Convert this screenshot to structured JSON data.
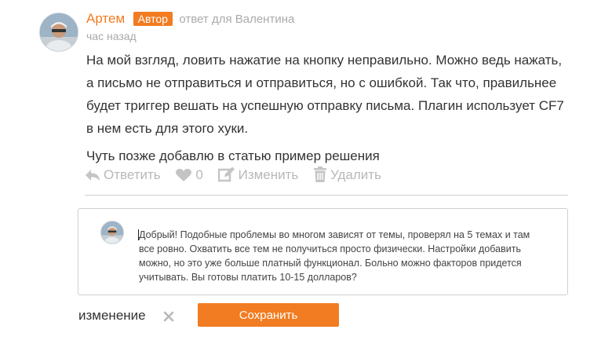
{
  "comment": {
    "author": "Артем",
    "badge": "Автор",
    "reply_to": "ответ для Валентина",
    "time": "час назад",
    "paragraphs": [
      "На мой взгляд, ловить нажатие на кнопку неправильно. Можно ведь нажать, а письмо не отправиться и отправиться, но с ошибкой. Так что, правильнее будет триггер вешать на успешную отправку письма. Плагин использует CF7 в нем есть для этого хуки.",
      "Чуть позже добавлю в статью пример решения"
    ],
    "actions": {
      "reply_label": "Ответить",
      "likes": "0",
      "edit_label": "Изменить",
      "delete_label": "Удалить"
    }
  },
  "editor": {
    "value": "Добрый! Подобные проблемы во многом зависят от темы, проверял на 5 темах и там все ровно. Охватить все тем не получиться просто физически. Настройки добавить можно, но это уже больше платный функционал. Больно можно факторов придется учитывать. Вы готовы платить 10-15 долларов?"
  },
  "footer": {
    "change_label": "изменение",
    "save_label": "Сохранить"
  },
  "colors": {
    "accent": "#f27c21",
    "muted": "#b8b8b8"
  }
}
